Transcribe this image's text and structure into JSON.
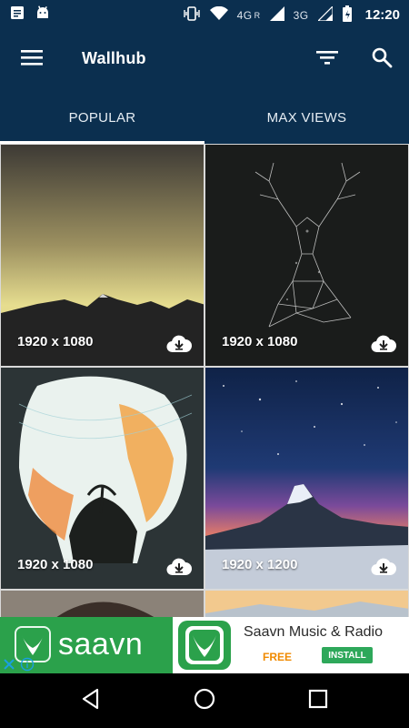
{
  "status_bar": {
    "time": "12:20",
    "network_labels": [
      "4G",
      "R",
      "3G"
    ],
    "icons": [
      "notes-icon",
      "android-icon",
      "vibrate-icon",
      "wifi-icon",
      "signal-icon",
      "battery-icon"
    ]
  },
  "app_bar": {
    "title": "Wallhub",
    "icons": [
      "menu-icon",
      "filter-icon",
      "search-icon"
    ]
  },
  "tabs": [
    {
      "label": "POPULAR",
      "active": true
    },
    {
      "label": "MAX VIEWS",
      "active": false
    }
  ],
  "wallpapers": [
    {
      "resolution": "1920 x 1080",
      "subject": "mountain-dusk"
    },
    {
      "resolution": "1920 x 1080",
      "subject": "polygon-deer"
    },
    {
      "resolution": "1920 x 1080",
      "subject": "skull-forest-art"
    },
    {
      "resolution": "1920 x 1200",
      "subject": "starry-mountain"
    },
    {
      "resolution": "",
      "subject": "partial-portrait"
    },
    {
      "resolution": "",
      "subject": "partial-landscape"
    }
  ],
  "ad": {
    "brand": "saavn",
    "app_name": "Saavn Music & Radio",
    "price": "FREE",
    "install_label": "INSTALL",
    "colors": {
      "brand_green": "#2ba14b",
      "price_orange": "#f08a00"
    }
  },
  "nav_bar": {
    "buttons": [
      "back-icon",
      "home-icon",
      "recents-icon"
    ]
  },
  "colors": {
    "primary": "#0b2f4f",
    "on_primary": "#ffffff"
  }
}
